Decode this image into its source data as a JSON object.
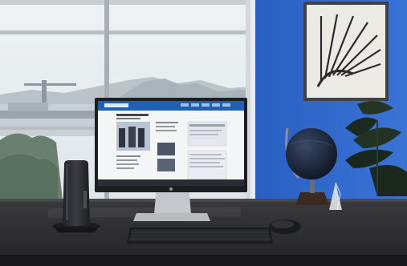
{
  "scene": {
    "description_free": true,
    "colors": {
      "wall_blue": "#2f67c9",
      "wall_blue_dark": "#2458b4",
      "desk_top": "#2c2c2e",
      "desk_edge": "#1b1b1c",
      "window_frame": "#cfd3d6",
      "window_glass": "#d9e1e6",
      "monitor_bezel": "#1d1f22",
      "screen_header": "#1d5fb8",
      "thin_client": "#2a2c30"
    },
    "objects": {
      "window": "window",
      "monitor": "monitor",
      "thin_client": "thin-client-pc",
      "keyboard": "keyboard",
      "mouse": "mouse",
      "globe": "globe",
      "plant": "potted-plant",
      "artwork": "framed-artwork",
      "crystal": "crystal-ornament"
    }
  }
}
